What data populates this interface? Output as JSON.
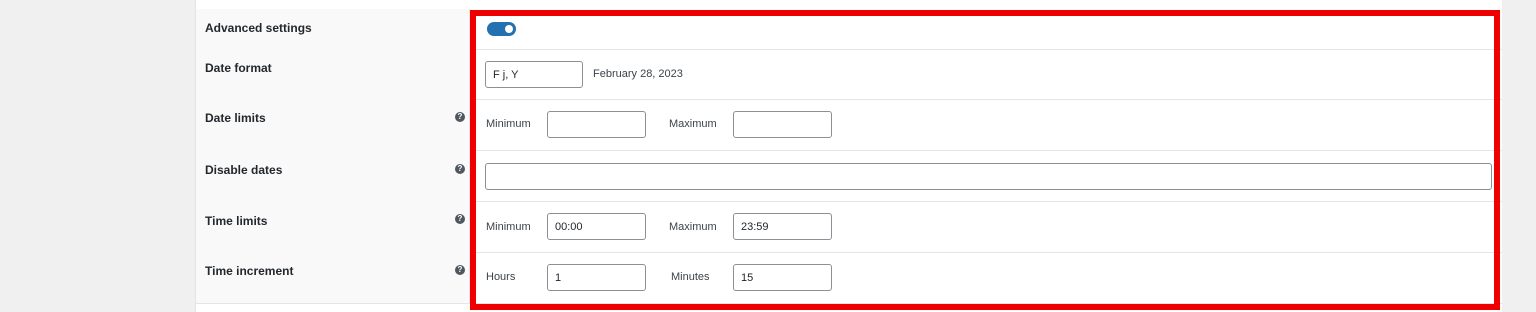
{
  "settings": {
    "advanced": {
      "label": "Advanced settings",
      "enabled": true
    },
    "date_format": {
      "label": "Date format",
      "value": "F j, Y",
      "preview": "February 28, 2023"
    },
    "date_limits": {
      "label": "Date limits",
      "help_icon": "question-circle-icon",
      "min_label": "Minimum",
      "min_value": "",
      "max_label": "Maximum",
      "max_value": ""
    },
    "disable_dates": {
      "label": "Disable dates",
      "help_icon": "question-circle-icon",
      "value": ""
    },
    "time_limits": {
      "label": "Time limits",
      "help_icon": "question-circle-icon",
      "min_label": "Minimum",
      "min_value": "00:00",
      "max_label": "Maximum",
      "max_value": "23:59"
    },
    "time_increment": {
      "label": "Time increment",
      "help_icon": "question-circle-icon",
      "hours_label": "Hours",
      "hours_value": "1",
      "minutes_label": "Minutes",
      "minutes_value": "15"
    }
  },
  "colors": {
    "toggle_on": "#2271b1",
    "highlight_border": "#ee0000"
  }
}
